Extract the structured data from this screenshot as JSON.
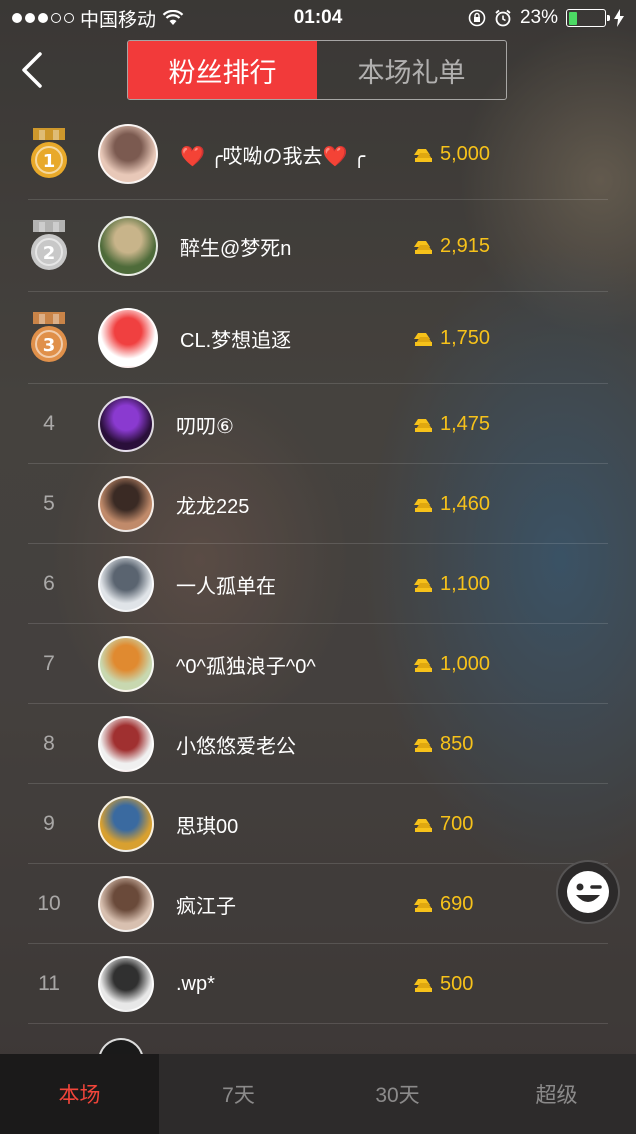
{
  "status_bar": {
    "carrier": "中国移动",
    "time": "01:04",
    "battery_percent": "23%",
    "battery_level": 0.23,
    "signal_bars": 3
  },
  "nav": {
    "tabs": [
      {
        "label": "粉丝排行",
        "active": true
      },
      {
        "label": "本场礼单",
        "active": false
      }
    ]
  },
  "ranking": [
    {
      "rank": "1",
      "name": "❤️ ╭哎呦の我去❤️ ╭",
      "coins": "5,000",
      "medal": "gold",
      "avatar": [
        "#e8c8b8",
        "#7b5a50"
      ]
    },
    {
      "rank": "2",
      "name": "醉生@梦死n",
      "coins": "2,915",
      "medal": "silver",
      "avatar": [
        "#4e6b3a",
        "#c8b48a"
      ]
    },
    {
      "rank": "3",
      "name": "CL.梦想追逐",
      "coins": "1,750",
      "medal": "bronze",
      "avatar": [
        "#ffffff",
        "#f04040"
      ]
    },
    {
      "rank": "4",
      "name": "叨叨⑥",
      "coins": "1,475",
      "avatar": [
        "#2a0f3a",
        "#8a3ad0"
      ]
    },
    {
      "rank": "5",
      "name": "龙龙225",
      "coins": "1,460",
      "avatar": [
        "#c08a6a",
        "#3a2a24"
      ]
    },
    {
      "rank": "6",
      "name": "一人孤单在",
      "coins": "1,100",
      "avatar": [
        "#e0e4e8",
        "#5a6470"
      ]
    },
    {
      "rank": "7",
      "name": "^0^孤独浪子^0^",
      "coins": "1,000",
      "avatar": [
        "#c8d8b0",
        "#e08a30"
      ]
    },
    {
      "rank": "8",
      "name": "小悠悠爱老公",
      "coins": "850",
      "avatar": [
        "#f0f0f0",
        "#a03030"
      ]
    },
    {
      "rank": "9",
      "name": "思琪00",
      "coins": "700",
      "avatar": [
        "#d8a030",
        "#3a6aa0"
      ]
    },
    {
      "rank": "10",
      "name": "疯江子",
      "coins": "690",
      "avatar": [
        "#d8c0b0",
        "#6a4a3a"
      ]
    },
    {
      "rank": "11",
      "name": ".wp*",
      "coins": "500",
      "avatar": [
        "#e8e8e8",
        "#303030"
      ]
    }
  ],
  "bottom_tabs": [
    {
      "label": "本场",
      "active": true
    },
    {
      "label": "7天",
      "active": false
    },
    {
      "label": "30天",
      "active": false
    },
    {
      "label": "超级",
      "active": false
    }
  ],
  "colors": {
    "accent_red": "#f23a3a",
    "coin_gold": "#f7c21a",
    "medal_gold": "#e8a92a",
    "medal_silver": "#c8c8c8",
    "medal_bronze": "#e0904a"
  },
  "icons": {
    "back": "chevron-left-icon",
    "coin": "gold-ingot-icon",
    "float": "winking-face-icon"
  }
}
